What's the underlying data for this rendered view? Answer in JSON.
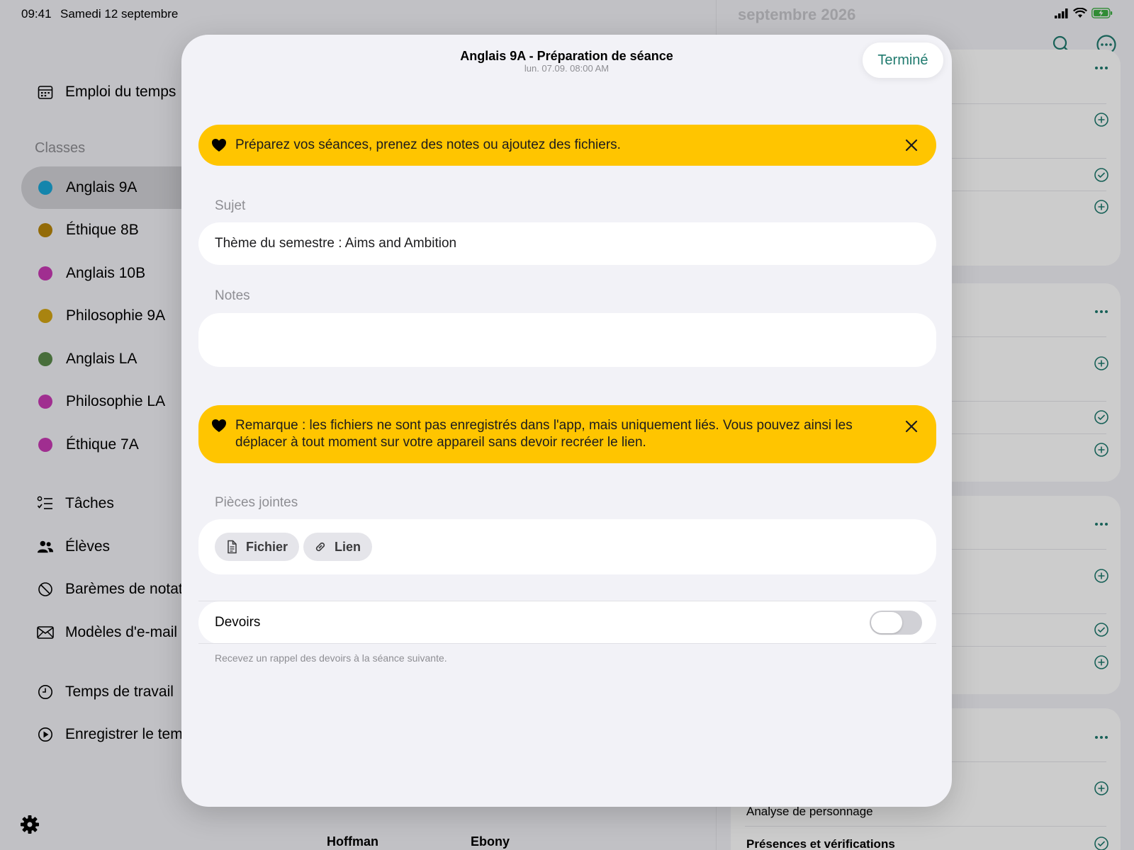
{
  "status_bar": {
    "time": "09:41",
    "date": "Samedi 12 septembre"
  },
  "sidebar": {
    "schedule_label": "Emploi du temps",
    "classes_title": "Classes",
    "classes": [
      {
        "label": "Anglais 9A",
        "color": "#1aa7d8",
        "selected": true
      },
      {
        "label": "Éthique 8B",
        "color": "#b8860b"
      },
      {
        "label": "Anglais 10B",
        "color": "#c83ab5"
      },
      {
        "label": "Philosophie 9A",
        "color": "#d4a514"
      },
      {
        "label": "Anglais LA",
        "color": "#5a8a4a"
      },
      {
        "label": "Philosophie LA",
        "color": "#c83ab5"
      },
      {
        "label": "Éthique 7A",
        "color": "#c83ab5"
      }
    ],
    "tools": [
      {
        "label": "Tâches",
        "icon": "tasks-icon"
      },
      {
        "label": "Élèves",
        "icon": "students-icon"
      },
      {
        "label": "Barèmes de notatio",
        "icon": "grading-scale-icon"
      },
      {
        "label": "Modèles d'e-mail",
        "icon": "email-icon"
      }
    ],
    "time": [
      {
        "label": "Temps de travail",
        "icon": "clock-icon"
      },
      {
        "label": "Enregistrer le temp",
        "icon": "record-icon"
      }
    ],
    "settings_icon": "gear-icon"
  },
  "background": {
    "right_header": "septembre 2026",
    "visible_row_text": "Analyse de personnage",
    "visible_row_bold": "Présences et vérifications",
    "bottom_names": [
      "Hoffman",
      "Ebony"
    ]
  },
  "modal": {
    "title": "Anglais 9A - Préparation de séance",
    "subtitle": "lun. 07.09. 08:00 AM",
    "done_label": "Terminé",
    "banner_top": "Préparez vos séances, prenez des notes ou ajoutez des fichiers.",
    "subject_label": "Sujet",
    "subject_value": "Thème du semestre : Aims and Ambition",
    "notes_label": "Notes",
    "notes_value": "",
    "banner_note": "Remarque : les fichiers ne sont pas enregistrés dans l'app, mais uniquement liés. Vous pouvez ainsi les déplacer à tout moment sur votre appareil sans devoir recréer le lien.",
    "attachments_label": "Pièces jointes",
    "file_button": "Fichier",
    "link_button": "Lien",
    "homework_label": "Devoirs",
    "homework_enabled": false,
    "homework_footnote": "Recevez un rappel des devoirs à la séance suivante."
  },
  "colors": {
    "accent": "#1f7a6e",
    "banner": "#ffc500"
  }
}
